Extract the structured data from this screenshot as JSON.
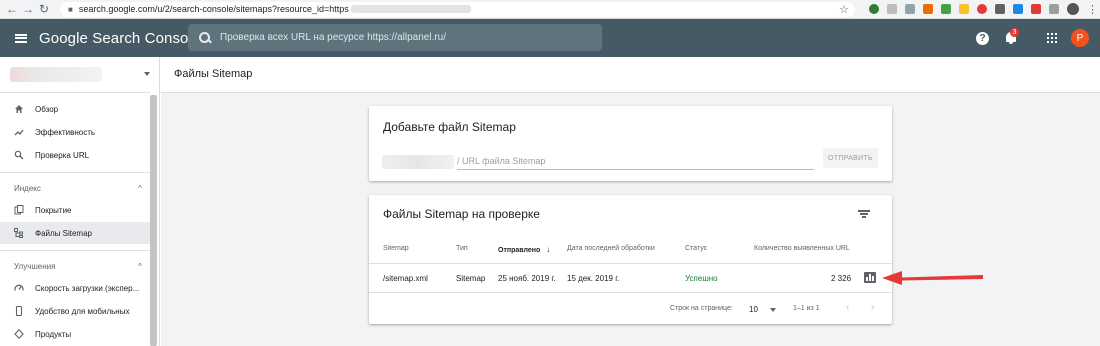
{
  "browser": {
    "url_prefix": "search.google.com/u/2/search-console/sitemaps?resource_id=https"
  },
  "header": {
    "brand": "Google Search Console",
    "search_placeholder": "Проверка всех URL на ресурсе https://allpanel.ru/",
    "notification_count": "3",
    "avatar_letter": "P",
    "help_glyph": "?"
  },
  "sidebar": {
    "items": [
      {
        "label": "Обзор",
        "icon": "home-icon"
      },
      {
        "label": "Эффективность",
        "icon": "trending-up-icon"
      },
      {
        "label": "Проверка URL",
        "icon": "search-icon"
      }
    ],
    "sections": [
      {
        "title": "Индекс",
        "items": [
          {
            "label": "Покрытие",
            "icon": "copy-icon"
          },
          {
            "label": "Файлы Sitemap",
            "icon": "sitemap-icon",
            "active": true
          }
        ]
      },
      {
        "title": "Улучшения",
        "items": [
          {
            "label": "Скорость загрузки (экспер...",
            "icon": "speed-icon"
          },
          {
            "label": "Удобство для мобильных",
            "icon": "phone-icon"
          },
          {
            "label": "Продукты",
            "icon": "diamond-icon"
          }
        ]
      }
    ]
  },
  "page": {
    "title": "Файлы Sitemap"
  },
  "add_card": {
    "title": "Добавьте файл Sitemap",
    "input_placeholder": "/ URL файла Sitemap",
    "submit_label": "ОТПРАВИТЬ"
  },
  "list_card": {
    "title": "Файлы Sitemap на проверке",
    "columns": [
      "Sitemap",
      "Тип",
      "Отправлено",
      "Дата последней обработки",
      "Статус",
      "Количество выявленных URL"
    ],
    "sort_glyph": "↓",
    "rows": [
      {
        "sitemap": "/sitemap.xml",
        "type": "Sitemap",
        "submitted": "25 нояб. 2019 г.",
        "last_read": "15 дек. 2019 г.",
        "status": "Успешно",
        "urls": "2 326"
      }
    ],
    "footer": {
      "rows_per_page_label": "Строк на странице:",
      "rows_per_page": "10",
      "range": "1–1 из 1",
      "prev_glyph": "‹",
      "next_glyph": "›"
    }
  },
  "colors": {
    "header_bg": "#455a64",
    "success": "#188038",
    "avatar": "#f4511e",
    "annotation_arrow": "#e53935"
  }
}
